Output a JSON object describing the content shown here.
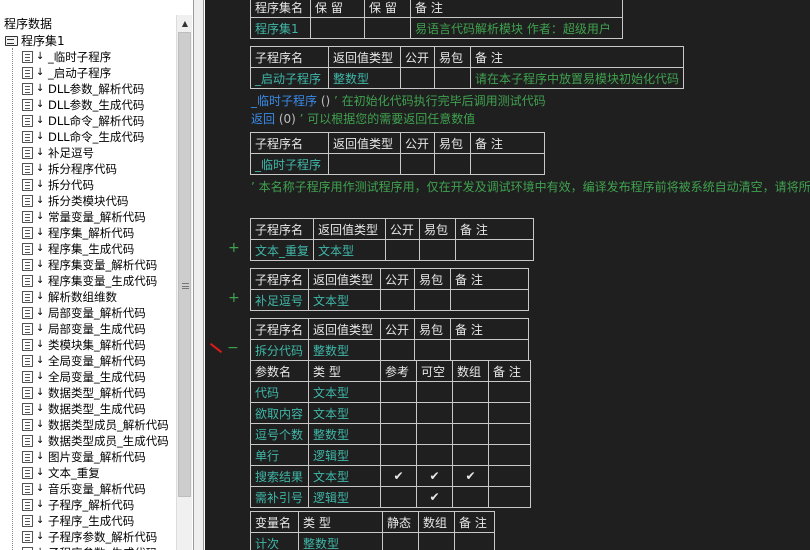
{
  "left_panel": {
    "title": "程序数据",
    "root": "程序集1",
    "items": [
      "_临时子程序",
      "_启动子程序",
      "DLL参数_解析代码",
      "DLL参数_生成代码",
      "DLL命令_解析代码",
      "DLL命令_生成代码",
      "补足逗号",
      "拆分程序代码",
      "拆分代码",
      "拆分类模块代码",
      "常量变量_解析代码",
      "程序集_解析代码",
      "程序集_生成代码",
      "程序集变量_解析代码",
      "程序集变量_生成代码",
      "解析数组维数",
      "局部变量_解析代码",
      "局部变量_生成代码",
      "类模块集_解析代码",
      "全局变量_解析代码",
      "全局变量_生成代码",
      "数据类型_解析代码",
      "数据类型_生成代码",
      "数据类型成员_解析代码",
      "数据类型成员_生成代码",
      "图片变量_解析代码",
      "文本_重复",
      "音乐变量_解析代码",
      "子程序_解析代码",
      "子程序_生成代码",
      "子程序参数_解析代码",
      "子程序参数_生成代码"
    ]
  },
  "editor": {
    "assembly_table": {
      "headers": [
        "程序集名",
        "保 留",
        "保 留",
        "备 注"
      ],
      "row": [
        "程序集1",
        "",
        "",
        "易语言代码解析模块   作者：超级用户"
      ]
    },
    "sub_headers": [
      "子程序名",
      "返回值类型",
      "公开",
      "易包",
      "备 注"
    ],
    "startup_sub": {
      "name": "_启动子程序",
      "type": "整数型",
      "public": "",
      "pkg": "",
      "note": "请在本子程序中放置易模块初始化代码"
    },
    "code_line1": {
      "name": "_临时子程序",
      "args": "()",
      "comment": "’ 在初始化代码执行完毕后调用测试代码"
    },
    "code_line2": {
      "keyword": "返回",
      "args": "(0)",
      "comment": "’ 可以根据您的需要返回任意数值"
    },
    "temp_sub": {
      "name": "_临时子程序",
      "type": ""
    },
    "temp_comment": "’ 本名称子程序用作测试程序用，仅在开发及调试环境中有效，编译发布程序前将被系统自动清空，请将所",
    "text_repeat_sub": {
      "name": "文本_重复",
      "type": "文本型",
      "expand": "+"
    },
    "comma_sub": {
      "name": "补足逗号",
      "type": "文本型",
      "expand": "+"
    },
    "split_sub": {
      "name": "拆分代码",
      "type": "整数型",
      "collapse": "−"
    },
    "param_headers": [
      "参数名",
      "类 型",
      "参考",
      "可空",
      "数组",
      "备 注"
    ],
    "params": [
      {
        "name": "代码",
        "type": "文本型",
        "ref": "",
        "nullable": "",
        "array": ""
      },
      {
        "name": "欲取内容",
        "type": "文本型",
        "ref": "",
        "nullable": "",
        "array": ""
      },
      {
        "name": "逗号个数",
        "type": "整数型",
        "ref": "",
        "nullable": "",
        "array": ""
      },
      {
        "name": "单行",
        "type": "逻辑型",
        "ref": "",
        "nullable": "",
        "array": ""
      },
      {
        "name": "搜索结果",
        "type": "文本型",
        "ref": "✔",
        "nullable": "✔",
        "array": "✔"
      },
      {
        "name": "需补引号",
        "type": "逻辑型",
        "ref": "",
        "nullable": "✔",
        "array": ""
      }
    ],
    "var_headers": [
      "变量名",
      "类 型",
      "静态",
      "数组",
      "备 注"
    ],
    "vars": [
      {
        "name": "计次",
        "type": "整数型"
      }
    ]
  },
  "colors": {
    "editor_bg": "#1f1f1f",
    "name_teal": "#3fb7a8",
    "comment_green": "#3fa24f",
    "keyword_blue": "#3a8be8"
  }
}
